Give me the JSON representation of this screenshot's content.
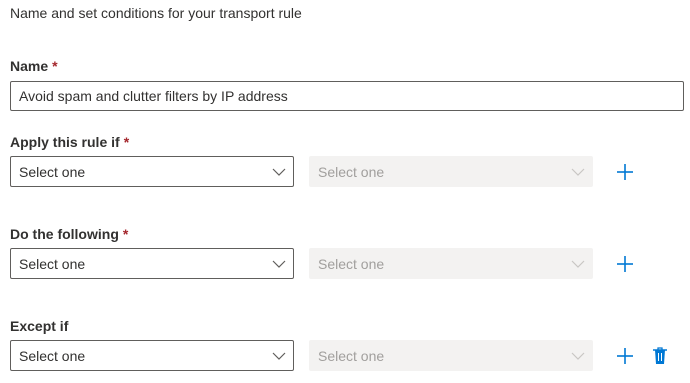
{
  "header": {
    "intro_text": "Name and set conditions for your transport rule"
  },
  "name_section": {
    "label": "Name",
    "required_marker": "*",
    "value": "Avoid spam and clutter filters by IP address"
  },
  "apply_section": {
    "label": "Apply this rule if",
    "required_marker": "*",
    "primary_select": "Select one",
    "secondary_select": "Select one"
  },
  "do_section": {
    "label": "Do the following",
    "required_marker": "*",
    "primary_select": "Select one",
    "secondary_select": "Select one"
  },
  "except_section": {
    "label": "Except if",
    "primary_select": "Select one",
    "secondary_select": "Select one"
  },
  "colors": {
    "accent": "#0078d4",
    "required": "#a4262c",
    "disabled_bg": "#f3f2f1",
    "disabled_text": "#a19f9d",
    "border": "#605e5c"
  },
  "icons": {
    "add": "add-icon",
    "delete": "trash-icon",
    "dropdown": "chevron-down-icon"
  }
}
